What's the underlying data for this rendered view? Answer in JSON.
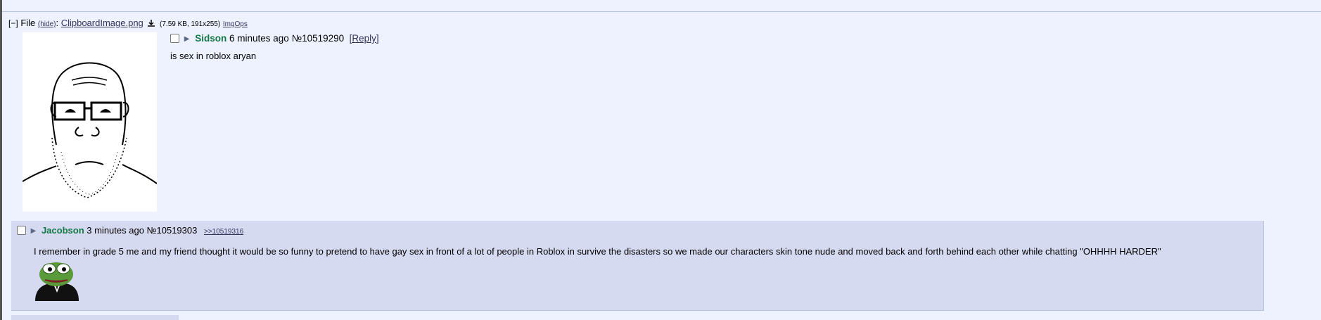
{
  "op": {
    "file_label": "File",
    "toggle": "[−]",
    "hide_label": "(hide)",
    "filename": "ClipboardImage.png",
    "file_meta": "(7.59 KB, 191x255)",
    "imgops": "ImgOps",
    "name": "Sidson",
    "time": "6 minutes ago",
    "post_no": "№10519290",
    "reply_label": "[Reply]",
    "body": "is sex in roblox aryan"
  },
  "reply": {
    "name": "Jacobson",
    "time": "3 minutes ago",
    "post_no": "№10519303",
    "backlink": ">>10519316",
    "body": "I remember in grade 5 me and my friend thought it would be so funny to pretend to have gay sex in front of a lot of people in Roblox in survive the disasters so we made our characters skin tone nude and moved back and forth behind each other while chatting \"OHHHH HARDER\""
  },
  "colors": {
    "background": "#eef2ff",
    "reply_background": "#d6daf0",
    "name": "#117743",
    "link": "#34345c"
  }
}
